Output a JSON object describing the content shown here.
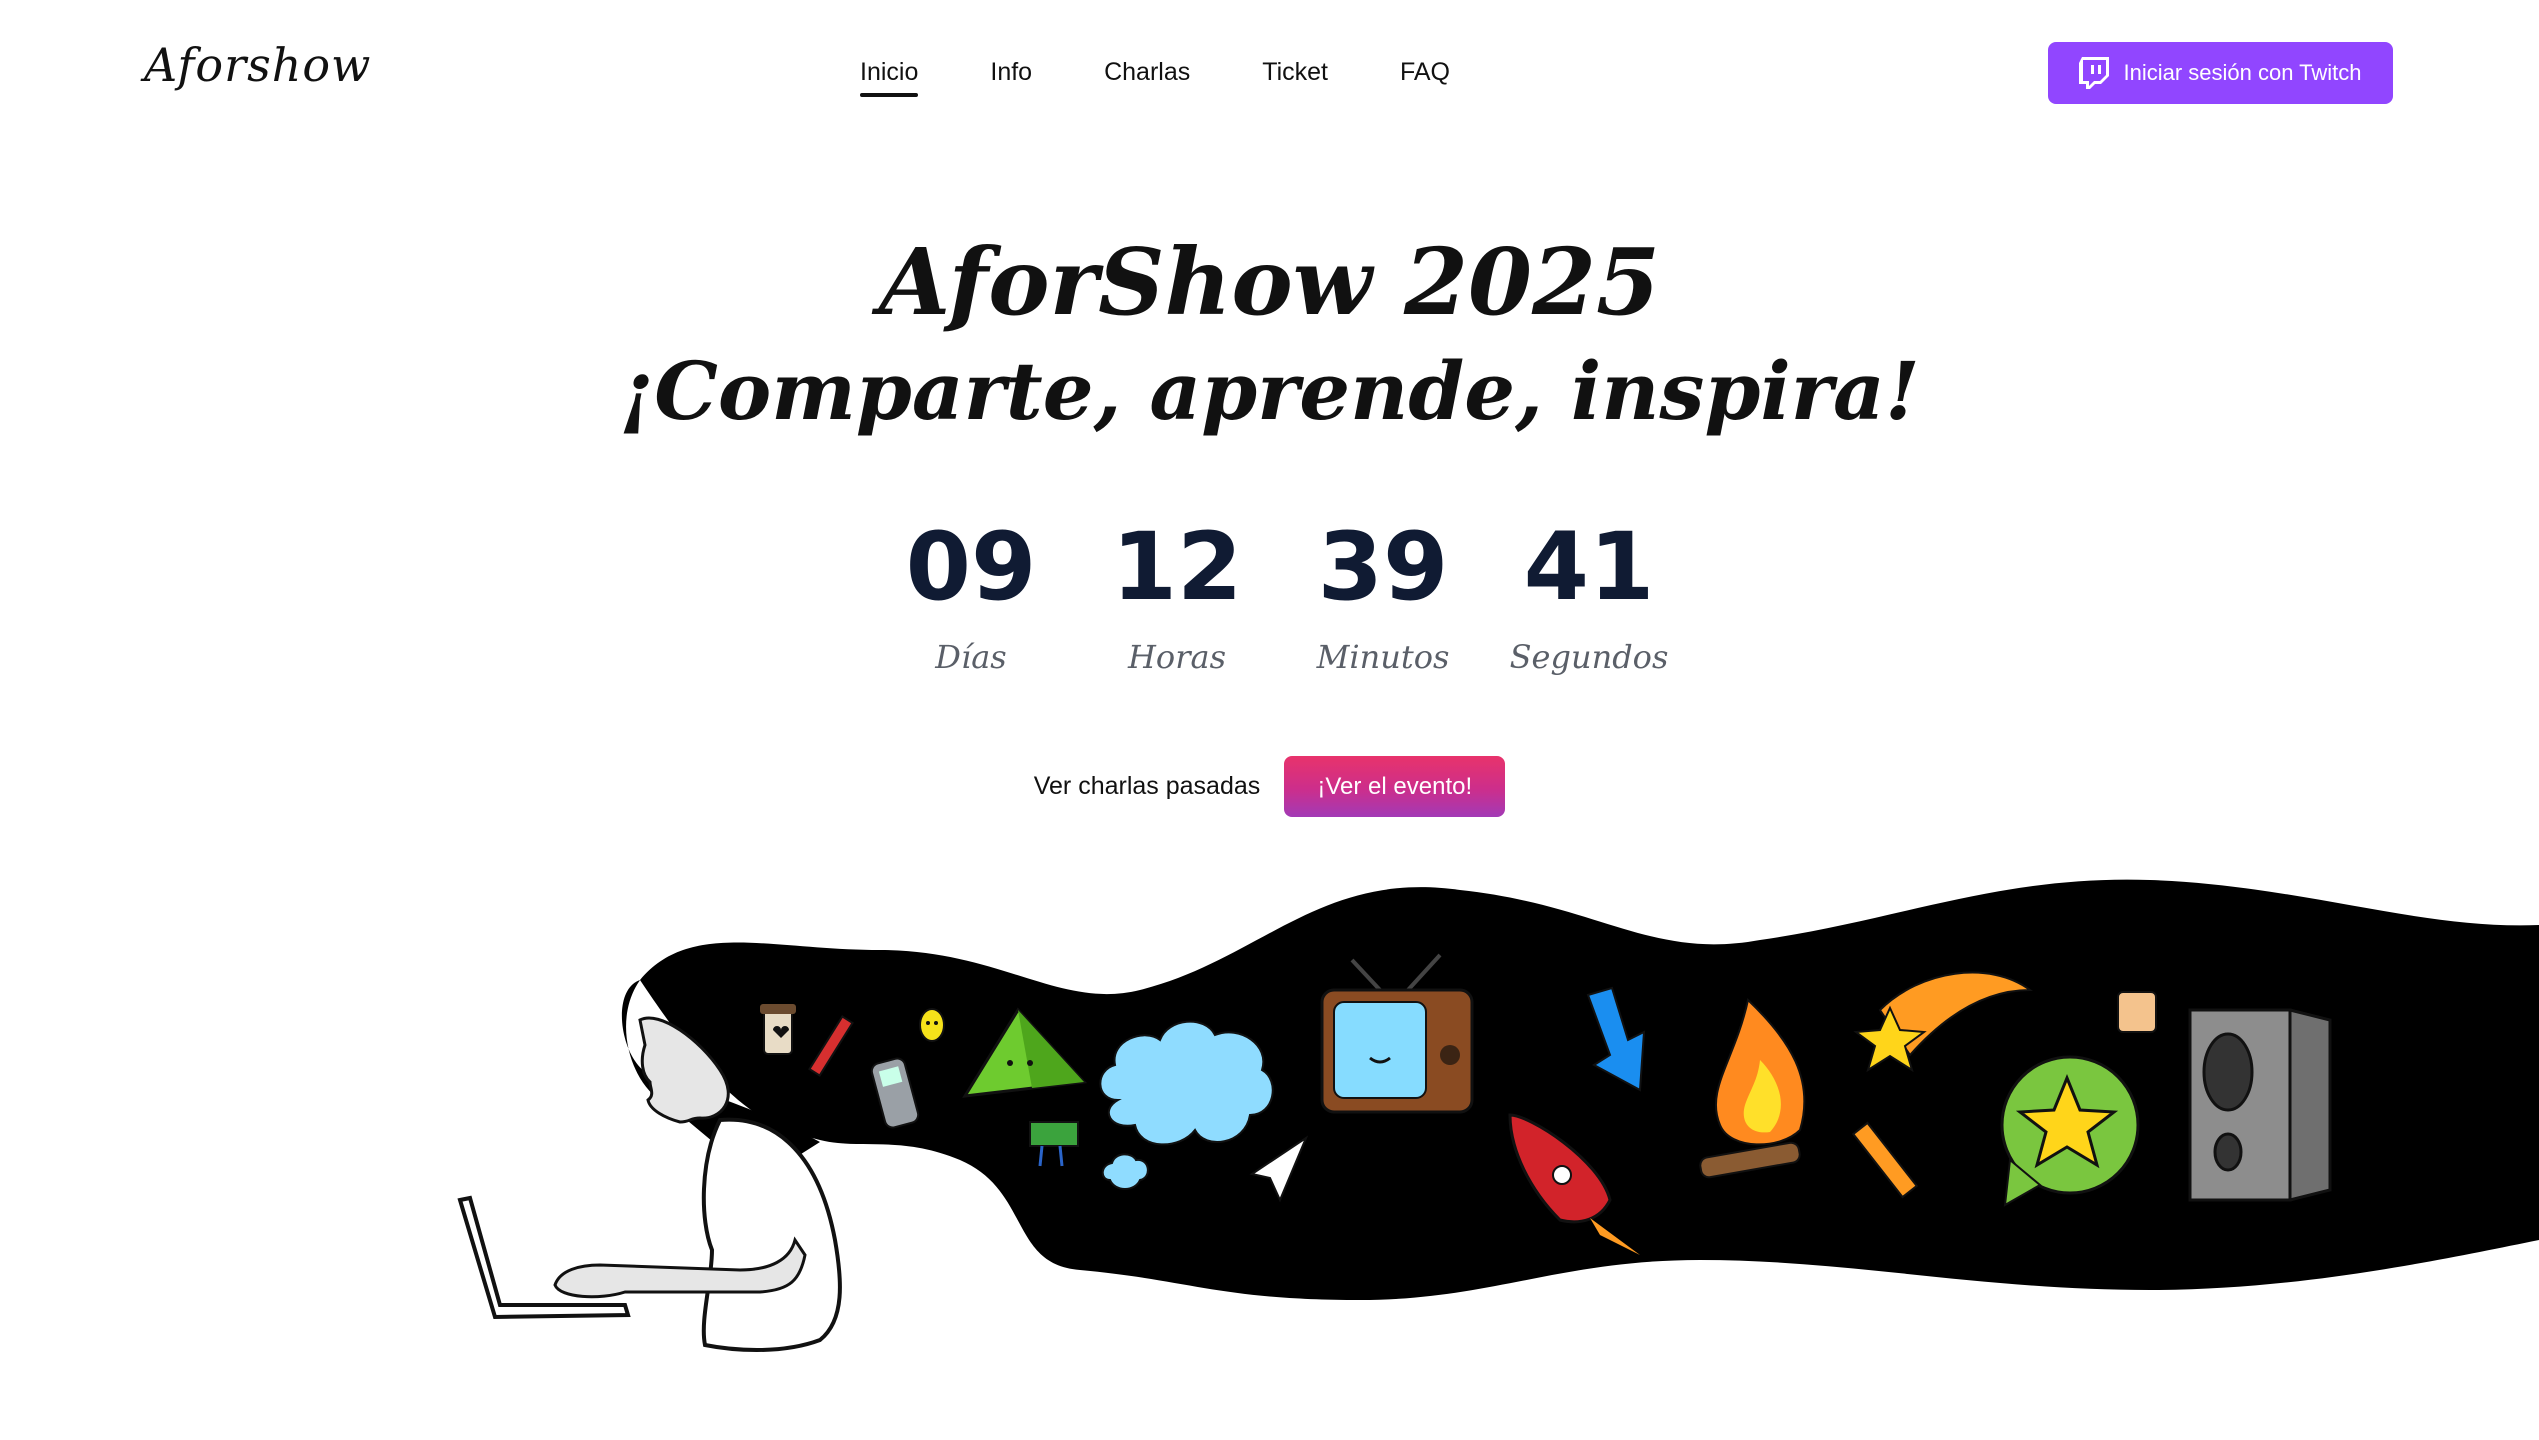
{
  "header": {
    "logo": "Aforshow",
    "nav": [
      {
        "label": "Inicio",
        "active": true
      },
      {
        "label": "Info",
        "active": false
      },
      {
        "label": "Charlas",
        "active": false
      },
      {
        "label": "Ticket",
        "active": false
      },
      {
        "label": "FAQ",
        "active": false
      }
    ],
    "login_button": "Iniciar sesión con Twitch",
    "login_icon": "twitch-icon"
  },
  "hero": {
    "title": "AforShow 2025",
    "subtitle": "¡Comparte, aprende, inspira!"
  },
  "countdown": [
    {
      "value": "09",
      "label": "Días"
    },
    {
      "value": "12",
      "label": "Horas"
    },
    {
      "value": "39",
      "label": "Minutos"
    },
    {
      "value": "41",
      "label": "Segundos"
    }
  ],
  "actions": {
    "past_talks": "Ver charlas pasadas",
    "watch_event": "¡Ver el evento!"
  },
  "colors": {
    "twitch": "#9146ff",
    "countdown_number": "#101b33",
    "event_gradient_top": "#e8336b",
    "event_gradient_bottom": "#a23ab6"
  }
}
